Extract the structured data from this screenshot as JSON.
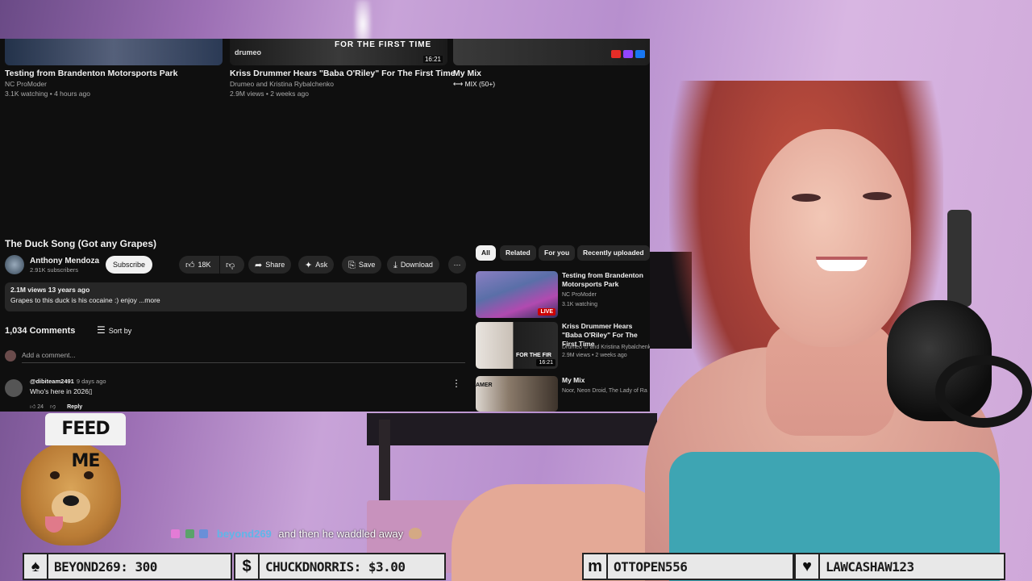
{
  "top_cards": [
    {
      "title": "Testing from Brandenton Motorsports Park",
      "channel": "NC ProModer",
      "meta": "3.1K watching • 4 hours ago"
    },
    {
      "title": "Kriss Drummer Hears \"Baba O'Riley\" For The First Time",
      "channel": "Drumeo and Kristina Rybalchenko",
      "meta": "2.9M views • 2 weeks ago",
      "thumb_logo": "drumeo",
      "thumb_text": "FOR THE FIRST TIME",
      "duration": "16:21"
    },
    {
      "title": "My Mix",
      "channel": "MIX (50+)"
    }
  ],
  "video": {
    "title": "The Duck Song (Got any Grapes)",
    "channel": "Anthony Mendoza",
    "subscribers": "2.91K subscribers",
    "subscribe_label": "Subscribe",
    "like_count": "18K",
    "share_label": "Share",
    "ask_label": "Ask",
    "save_label": "Save",
    "download_label": "Download",
    "stats": "2.1M views  13 years ago",
    "description": "Grapes to this duck is his cocaine :) enjoy ...more"
  },
  "comments": {
    "count_label": "1,034 Comments",
    "sort_label": "Sort by",
    "placeholder": "Add a comment...",
    "items": [
      {
        "author": "@dibiteam2491",
        "time": "9 days ago",
        "text": "Who's here in 2026▯",
        "likes": "24",
        "reply": "Reply"
      }
    ]
  },
  "chips": [
    "All",
    "Related",
    "For you",
    "Recently uploaded"
  ],
  "recommendations": [
    {
      "title": "Testing from Brandenton Motorsports Park",
      "channel": "NC ProModer",
      "meta": "3.1K watching",
      "badge": "LIVE"
    },
    {
      "title": "Kriss Drummer Hears \"Baba O'Riley\" For The First Time",
      "channel": "Drumeo ⊙ and Kristina Rybalchenko",
      "meta": "2.9M views • 2 weeks ago",
      "badge": "16:21",
      "thumb_text": "FOR THE FIR"
    },
    {
      "title": "My Mix",
      "channel": "Noor, Neon Droid, The Lady of Ra",
      "thumb_text": "AMER"
    }
  ],
  "overlay": {
    "dog_hat": "FEED ME",
    "chat": {
      "user": "beyond269",
      "message": "and then he waddled away"
    }
  },
  "event_bars": [
    {
      "icon": "♠",
      "label": "BEYOND269: 300"
    },
    {
      "icon": "$",
      "label": "CHUCKDNORRIS: $3.00"
    },
    {
      "icon": "m",
      "label": "OTTOPEN556"
    },
    {
      "icon": "♥",
      "label": "LAWCASHAW123"
    }
  ],
  "colors": {
    "yt_bg": "#0f0f0f",
    "live_red": "#cc0000",
    "chat_user": "#5fb6e8",
    "top_shirt": "#3ea5b3"
  }
}
